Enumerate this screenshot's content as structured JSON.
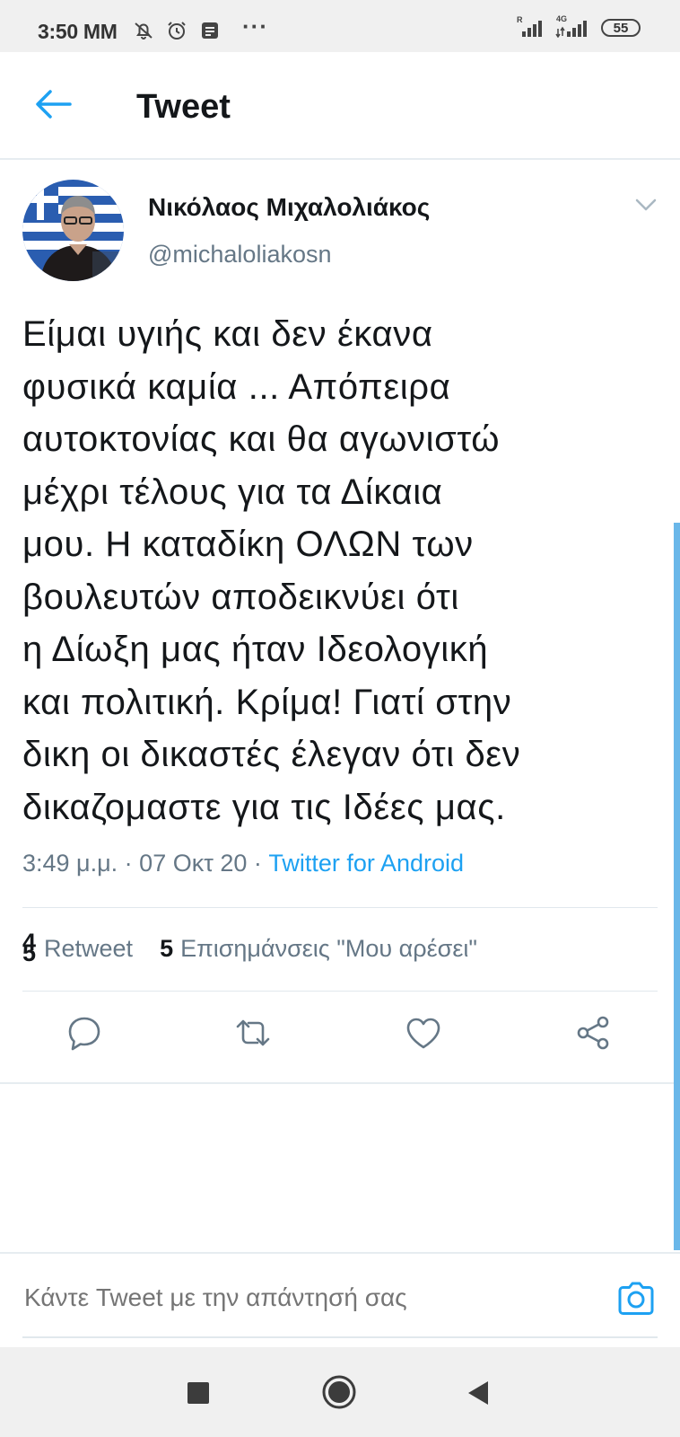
{
  "status_bar": {
    "time": "3:50 MM",
    "more": "···",
    "signal1_label": "R",
    "signal2_label": "4G",
    "battery": "55"
  },
  "header": {
    "title": "Tweet"
  },
  "tweet": {
    "author_name": "Νικόλαος Μιχαλολιάκος",
    "author_handle": "@michaloliakosn",
    "text": "Είμαι υγιής και δεν έκανα\nφυσικά καμία ... Απόπειρα\nαυτοκτονίας και θα αγωνιστώ\nμέχρι τέλους για τα Δίκαια\nμου. Η καταδίκη ΟΛΩΝ των\nβουλευτών αποδεικνύει ότι\nη Δίωξη μας ήταν Ιδεολογική\nκαι πολιτική. Κρίμα! Γιατί στην\nδικη οι δικαστές έλεγαν ότι δεν\nδικαζομαστε για τις Ιδέες μας.",
    "time": "3:49 μ.μ.",
    "separator": " · ",
    "date": "07 Οκτ 20",
    "source": "Twitter for Android"
  },
  "stats": {
    "retweets_old": "4",
    "retweets_new": "5",
    "retweets_label": "Retweet",
    "likes_count": "5",
    "likes_label": "Επισημάνσεις \"Μου αρέσει\""
  },
  "reply": {
    "placeholder": "Κάντε Tweet με την απάντησή σας"
  },
  "colors": {
    "accent": "#1da1f2",
    "secondary_text": "#657786",
    "primary_text": "#14171a",
    "divider": "#e1e8ed"
  },
  "icons": {
    "back": "arrow-left-icon",
    "caret": "chevron-down-icon",
    "reply": "comment-icon",
    "retweet": "retweet-icon",
    "like": "heart-icon",
    "share": "share-icon",
    "camera": "camera-icon",
    "nav_recents": "square-icon",
    "nav_home": "circle-icon",
    "nav_back": "triangle-back-icon"
  }
}
